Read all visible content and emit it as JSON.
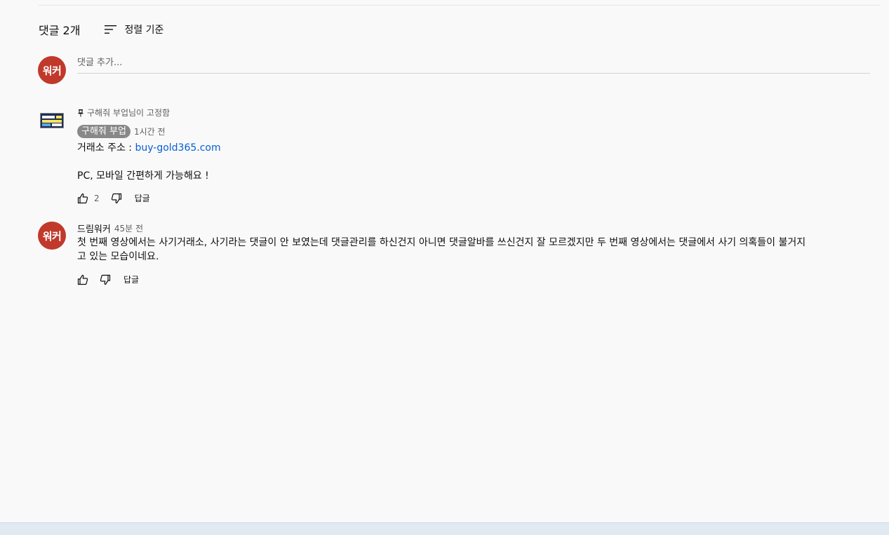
{
  "header": {
    "comment_count": "댓글 2개",
    "sort_label": "정렬 기준"
  },
  "composer": {
    "avatar_text": "워커",
    "placeholder": "댓글 추가..."
  },
  "comments": [
    {
      "pinned_label": "구해줘 부업님이 고정함",
      "author": "구해줘 부업",
      "timestamp": "1시간 전",
      "line1_prefix": "거래소 주소 : ",
      "line1_link": "buy-gold365.com",
      "line2": "PC, 모바일 간편하게 가능해요 !",
      "likes": "2",
      "reply_label": "답글"
    },
    {
      "avatar_text": "워커",
      "author": "드림워커",
      "timestamp": "45분 전",
      "text_line1": "첫 번째 영상에서는 사기거래소, 사기라는 댓글이 안 보였는데 댓글관리를 하신건지 아니면 댓글알바를 쓰신건지 잘 모르겠지만 두 번째 영상에서는 댓글에서 사기 의혹들이 불거지",
      "text_line2": "고 있는 모습이네요.",
      "reply_label": "답글"
    }
  ],
  "colors": {
    "avatar_bg": "#c0392b",
    "link": "#065fd4",
    "badge_bg": "#888888"
  }
}
